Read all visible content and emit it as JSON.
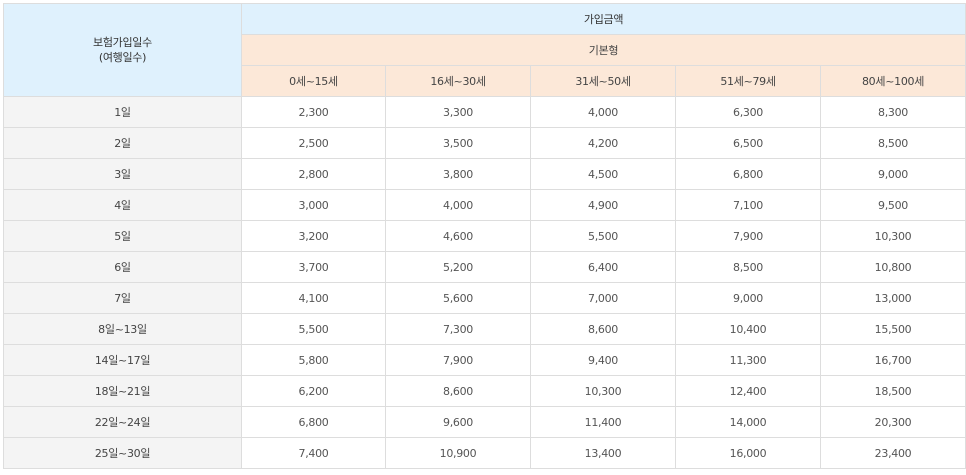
{
  "header": {
    "days_label_line1": "보험가입일수",
    "days_label_line2": "(여행일수)",
    "amount_label": "가입금액",
    "type_label": "기본형",
    "age_groups": [
      "0세~15세",
      "16세~30세",
      "31세~50세",
      "51세~79세",
      "80세~100세"
    ]
  },
  "rows": [
    {
      "days": "1일",
      "values": [
        "2,300",
        "3,300",
        "4,000",
        "6,300",
        "8,300"
      ]
    },
    {
      "days": "2일",
      "values": [
        "2,500",
        "3,500",
        "4,200",
        "6,500",
        "8,500"
      ]
    },
    {
      "days": "3일",
      "values": [
        "2,800",
        "3,800",
        "4,500",
        "6,800",
        "9,000"
      ]
    },
    {
      "days": "4일",
      "values": [
        "3,000",
        "4,000",
        "4,900",
        "7,100",
        "9,500"
      ]
    },
    {
      "days": "5일",
      "values": [
        "3,200",
        "4,600",
        "5,500",
        "7,900",
        "10,300"
      ]
    },
    {
      "days": "6일",
      "values": [
        "3,700",
        "5,200",
        "6,400",
        "8,500",
        "10,800"
      ]
    },
    {
      "days": "7일",
      "values": [
        "4,100",
        "5,600",
        "7,000",
        "9,000",
        "13,000"
      ]
    },
    {
      "days": "8일~13일",
      "values": [
        "5,500",
        "7,300",
        "8,600",
        "10,400",
        "15,500"
      ]
    },
    {
      "days": "14일~17일",
      "values": [
        "5,800",
        "7,900",
        "9,400",
        "11,300",
        "16,700"
      ]
    },
    {
      "days": "18일~21일",
      "values": [
        "6,200",
        "8,600",
        "10,300",
        "12,400",
        "18,500"
      ]
    },
    {
      "days": "22일~24일",
      "values": [
        "6,800",
        "9,600",
        "11,400",
        "14,000",
        "20,300"
      ]
    },
    {
      "days": "25일~30일",
      "values": [
        "7,400",
        "10,900",
        "13,400",
        "16,000",
        "23,400"
      ]
    }
  ]
}
